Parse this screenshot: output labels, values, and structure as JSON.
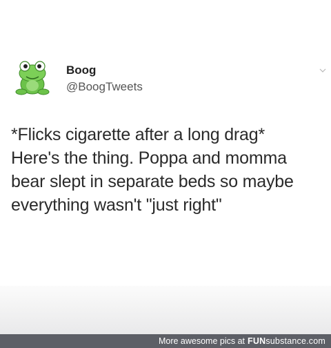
{
  "tweet": {
    "display_name": "Boog",
    "handle": "@BoogTweets",
    "lines": [
      "*Flicks cigarette after a long drag*",
      "Here's the thing. Poppa and momma",
      "bear slept in separate beds so maybe",
      "everything wasn't \"just right\""
    ]
  },
  "footer": {
    "caption": "More awesome pics at",
    "brand_bold": "FUN",
    "brand_rest": "substance.com"
  },
  "colors": {
    "frog_green": "#6cc24a",
    "footer_bg": "#5d5f66"
  },
  "icons": {
    "avatar": "frog-avatar-icon",
    "menu": "chevron-down-icon"
  }
}
